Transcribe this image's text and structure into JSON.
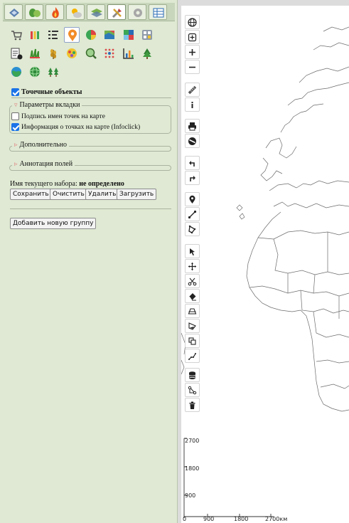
{
  "tabs": [
    {
      "icon": "layers-tool-icon"
    },
    {
      "icon": "plants-icon"
    },
    {
      "icon": "fire-icon"
    },
    {
      "icon": "weather-icon"
    },
    {
      "icon": "stack-layers-icon"
    },
    {
      "icon": "tools-icon",
      "active": true
    },
    {
      "icon": "settings-gear-icon"
    },
    {
      "icon": "table-icon"
    }
  ],
  "toolbox_icons": [
    "cart-icon",
    "bar-chart-icon",
    "legend-list-icon",
    "map-pin-icon",
    "pie-chart-icon",
    "thematic-map-icon",
    "color-grid-icon",
    "calculator-icon",
    "report-icon",
    "grass-icon",
    "wheat-icon",
    "pollen-icon",
    "search-magnify-icon",
    "dot-grid-icon",
    "statistics-chart-icon",
    "forest-icon",
    "globe-icon",
    "sphere-icon",
    "trees-icon"
  ],
  "point_objects": {
    "label": "Точечные объекты",
    "checked": true
  },
  "tab_params": {
    "legend": "Параметры вкладки",
    "options": [
      {
        "label": "Подпись имен точек на карте",
        "checked": false
      },
      {
        "label": "Информация о точках на карте (Infoclick)",
        "checked": true
      }
    ]
  },
  "sections": {
    "additional": "Дополнительно",
    "field_annotation": "Аннотация полей"
  },
  "current_set": {
    "label": "Имя текущего набора:",
    "value": "не определено"
  },
  "buttons": {
    "save": "Сохранить",
    "clear": "Очистить",
    "delete": "Удалить",
    "load": "Загрузить",
    "add_group": "Добавить новую группу"
  },
  "map_tools": [
    "globe-icon",
    "fit-extent-icon",
    "zoom-in-icon",
    "zoom-out-icon",
    "ruler-icon",
    "info-icon",
    "print-icon",
    "no-entry-icon",
    "undo-icon",
    "redo-icon",
    "point-marker-icon",
    "line-draw-icon",
    "polygon-draw-icon",
    "select-pointer-icon",
    "move-icon",
    "cut-icon",
    "eraser-icon",
    "trapezoid-icon",
    "fill-shape-icon",
    "copy-shape-icon",
    "step-line-icon",
    "database-icon",
    "path-node-icon",
    "trash-icon"
  ],
  "scale": {
    "y_labels": [
      "2700",
      "1800",
      "900"
    ],
    "x_labels": [
      "0",
      "900",
      "1800",
      "2700км"
    ]
  },
  "colors": {
    "panel_bg": "#dfe9d3",
    "accent": "#1a73e8",
    "legend_arrow": "#e27a7a"
  }
}
